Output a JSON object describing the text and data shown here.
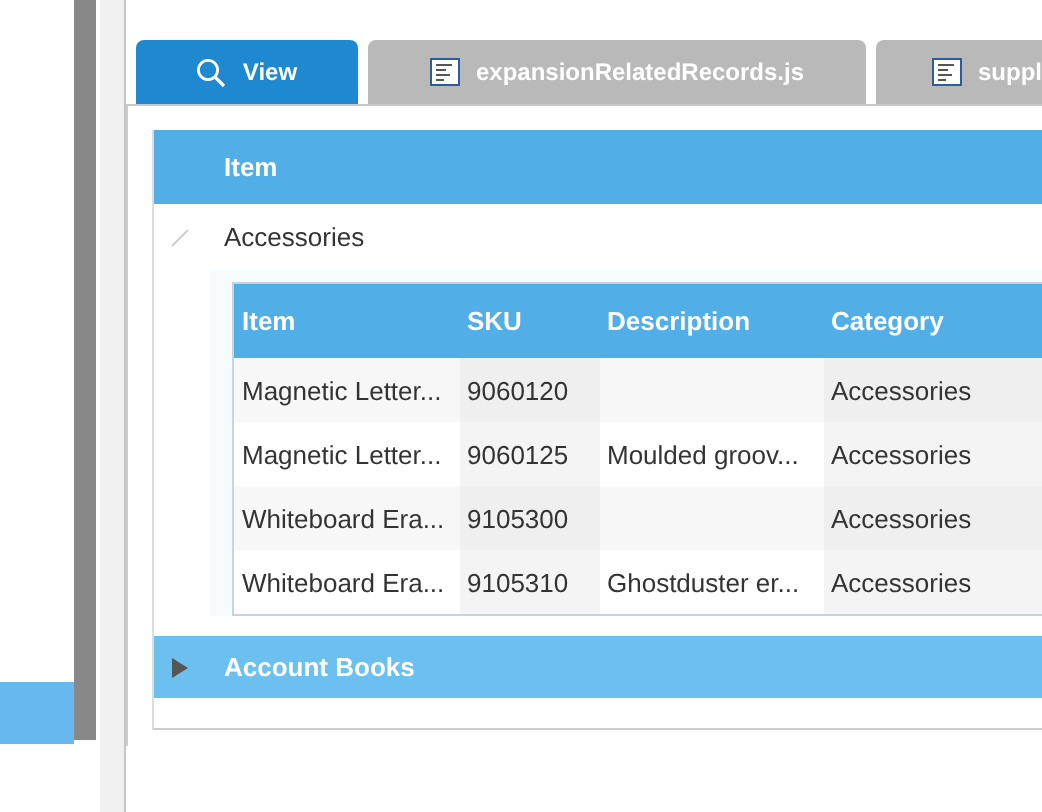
{
  "sidebar": {
    "items": [
      {
        "selected": true
      }
    ]
  },
  "tabs": [
    {
      "label": "View",
      "kind": "search",
      "selected": true
    },
    {
      "label": "expansionRelatedRecords.js",
      "kind": "file",
      "selected": false
    },
    {
      "label": "suppl",
      "kind": "file",
      "selected": false
    }
  ],
  "grid": {
    "columns": [
      "Item"
    ],
    "groups": [
      {
        "label": "Accessories",
        "expanded": true,
        "selected": false,
        "table": {
          "columns": [
            "Item",
            "SKU",
            "Description",
            "Category"
          ],
          "rows": [
            [
              "Magnetic Letter...",
              "9060120",
              "",
              "Accessories"
            ],
            [
              "Magnetic Letter...",
              "9060125",
              "Moulded groov...",
              "Accessories"
            ],
            [
              "Whiteboard Era...",
              "9105300",
              "",
              "Accessories"
            ],
            [
              "Whiteboard Era...",
              "9105310",
              "Ghostduster er...",
              "Accessories"
            ]
          ]
        }
      },
      {
        "label": "Account Books",
        "expanded": false,
        "selected": true
      }
    ]
  }
}
